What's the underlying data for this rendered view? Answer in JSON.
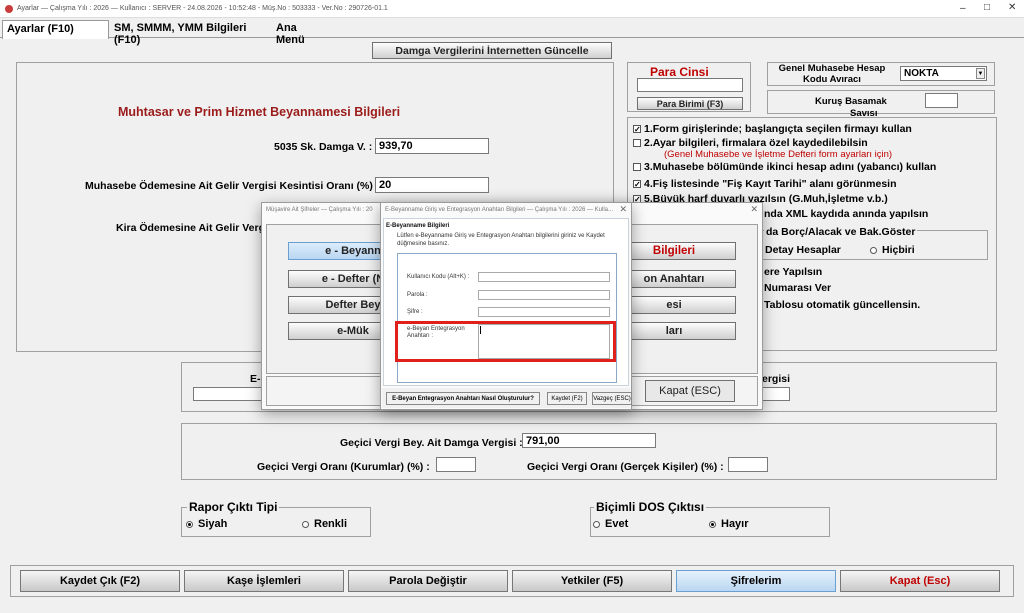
{
  "window": {
    "title": "Ayarlar — Çalışma Yılı : 2026 — Kullanıcı : SERVER - 24.08.2026 - 10:52:48 - Müş.No : 503333 - Ver.No : 290726-01.1"
  },
  "tabs": [
    {
      "label": "Ayarlar (F10)"
    },
    {
      "label": "SM, SMMM, YMM Bilgileri (F10)"
    },
    {
      "label": "Ana Menü"
    }
  ],
  "update_button": "Damga Vergilerini İnternetten Güncelle",
  "muhtasar": {
    "title": "Muhtasar ve Prim Hizmet Beyannamesi Bilgileri",
    "damga_label": "5035 Sk. Damga V. :",
    "damga_value": "939,70",
    "kesinti_label": "Muhasebe Ödemesine Ait Gelir Vergisi Kesintisi Oranı (%) :",
    "kesinti_value": "20",
    "kira_label": "Kira Ödemesine Ait Gelir Vergi"
  },
  "para": {
    "title": "Para Cinsi",
    "value": "",
    "button": "Para Birimi (F3)"
  },
  "hesap_ayirac": {
    "label_line1": "Genel Muhasebe Hesap",
    "label_line2": "Kodu Avıracı",
    "value": "NOKTA"
  },
  "kurus": {
    "label_line1": "Kuruş Basamak",
    "label_line2": "Savısı",
    "value": ""
  },
  "options": [
    {
      "text": "1.Form girişlerinde; başlangıçta seçilen firmayı kullan",
      "checked": true
    },
    {
      "text": "2.Ayar bilgileri, firmalara özel kaydedilebilsin",
      "checked": false
    },
    {
      "text": "3.Muhasebe bölümünde ikinci hesap adını (yabancı) kullan",
      "checked": false
    },
    {
      "text": "4.Fiş listesinde \"Fiş Kayıt Tarihi\" alanı görünmesin",
      "checked": true
    },
    {
      "text": "5.Büyük harf duyarlı yazılsın (G.Muh,İşletme v.b.)",
      "checked": true
    }
  ],
  "option2_note": "(Genel Muhasebe ve İşletme Defteri form ayarları için)",
  "partial_options": {
    "xml": "nda XML kaydıda anında yapılsın",
    "borc_group": "da Borç/Alacak ve Bak.Göster",
    "detay": "Detay Hesaplar",
    "hicbiri": "Hiçbiri",
    "ere": "ere Yapılsın",
    "numarasi": "Numarası Ver",
    "tablosu": "Tablosu otomatik güncellensin."
  },
  "behind_buttons": {
    "bilgileri": "Bilgileri",
    "on_anahtari": "on Anahtarı",
    "esi": "esi",
    "lari": "ları",
    "kapat": "Kapat (ESC)",
    "vergisi": "ergisi",
    "e_prefix": "E-"
  },
  "gecici": {
    "damga_label": "Geçici Vergi Bey. Ait Damga Vergisi :",
    "damga_value": "791,00",
    "kurumlar_label": "Geçici Vergi Oranı (Kurumlar) (%) :",
    "kurumlar_value": "",
    "gercek_label": "Geçici Vergi Oranı (Gerçek Kişiler) (%) :",
    "gercek_value": ""
  },
  "rapor": {
    "title": "Rapor Çıktı Tipi",
    "options": [
      "Siyah",
      "Renkli"
    ],
    "selected": "Siyah"
  },
  "dos": {
    "title": "Biçimli DOS Çıktısı",
    "options": [
      "Evet",
      "Hayır"
    ],
    "selected": "Hayır"
  },
  "bottom_buttons": [
    "Kaydet Çık (F2)",
    "Kaşe İşlemleri",
    "Parola Değiştir",
    "Yetkiler (F5)",
    "Şifrelerim",
    "Kapat (Esc)"
  ],
  "dialog_mid": {
    "title": "Müşavire Ait Şifreler — Çalışma Yılı : 20",
    "buttons": [
      "e - Beyann",
      "e - Defter (N",
      "Defter Bey",
      "e-Mük"
    ]
  },
  "dialog_front": {
    "title": "E-Beyanname Giriş ve Entegrasyon Anahtarı Bilgileri — Çalışma Yılı : 2026 — Kulla...",
    "section": "E-Beyanname Bilgileri",
    "info": "Lütfen e-Beyanname Giriş ve Entegrasyon Anahtarı bilgilerini giriniz ve Kaydet düğmesine basınız.",
    "user_label": "Kullanıcı Kodu (Alt+K) :",
    "parola_label": "Parola :",
    "sifre_label": "Şifre :",
    "key_label_line1": "e-Beyan Entegrasyon",
    "key_label_line2": "Anahtarı :",
    "user_value": "",
    "parola_value": "",
    "sifre_value": "",
    "key_value": "",
    "help_button": "E-Beyan Entegrasyon Anahtarı Nasıl Oluşturulur?",
    "save_button": "Kaydet (F2)",
    "cancel_button": "Vazgeç (ESC)"
  },
  "colors": {
    "highlight_red": "#e0201b",
    "title_red": "#9b1b1b",
    "accent_blue": "#cfe3f7"
  }
}
